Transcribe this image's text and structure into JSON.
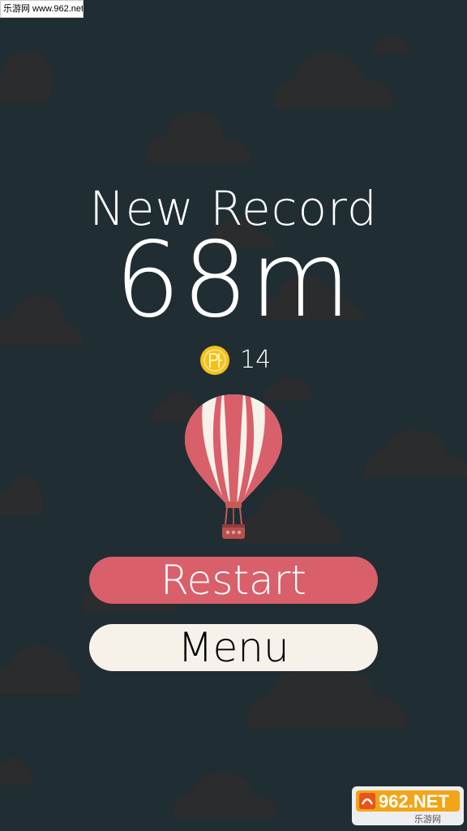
{
  "watermark": {
    "text": "乐游网 www.962.net"
  },
  "game_over": {
    "title": "New Record",
    "distance": "68m",
    "coins": "14"
  },
  "buttons": {
    "restart": "Restart",
    "menu": "Menu"
  },
  "logo": {
    "brand": "962.NET",
    "subtitle": "乐游网"
  },
  "colors": {
    "background": "#202d33",
    "cloud": "#2c2d2e",
    "restart": "#d95f6b",
    "menu": "#f6f2ea",
    "coin": "#f3c01c",
    "balloon_red": "#d95f6b",
    "balloon_white": "#f7f2e8"
  },
  "icons": {
    "coin": "coin-icon",
    "balloon": "hot-air-balloon-icon",
    "logo": "962net-logo"
  }
}
